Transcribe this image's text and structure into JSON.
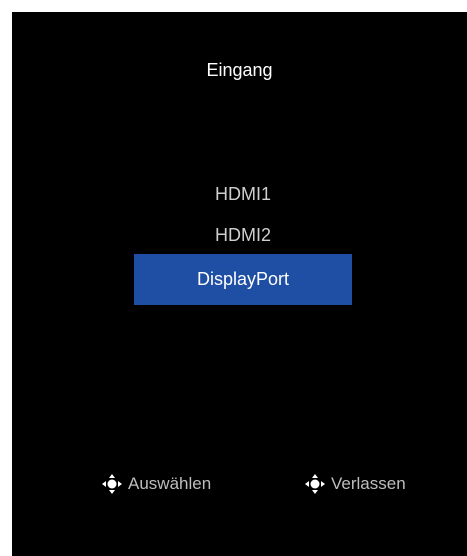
{
  "osd": {
    "title": "Eingang",
    "inputs": [
      {
        "label": "HDMI1",
        "selected": false
      },
      {
        "label": "HDMI2",
        "selected": false
      },
      {
        "label": "DisplayPort",
        "selected": true
      }
    ],
    "hints": {
      "select_label": "Auswählen",
      "select_icon": "joystick-nav-icon",
      "exit_label": "Verlassen",
      "exit_icon": "joystick-nav-icon"
    }
  },
  "colors": {
    "background": "#000000",
    "highlight": "#1f4ea5",
    "text": "#ffffff",
    "muted_text": "#cfcfcf"
  }
}
